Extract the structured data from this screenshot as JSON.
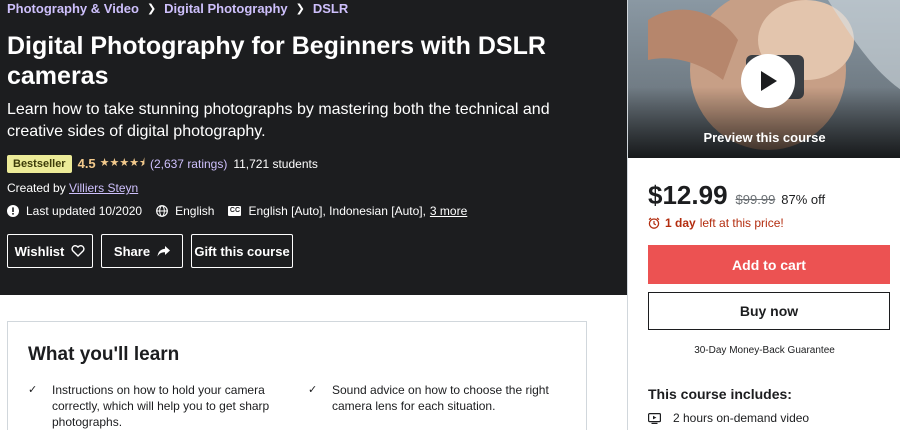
{
  "breadcrumb": [
    "Photography & Video",
    "Digital Photography",
    "DSLR"
  ],
  "course": {
    "title": "Digital Photography for Beginners with DSLR cameras",
    "subtitle": "Learn how to take stunning photographs by mastering both the technical and creative sides of digital photography.",
    "badge": "Bestseller",
    "rating": "4.5",
    "rating_count": "(2,637 ratings)",
    "students": "11,721 students",
    "created_by_label": "Created by",
    "author": "Villiers Steyn",
    "last_updated": "Last updated 10/2020",
    "language": "English",
    "captions": "English [Auto], Indonesian [Auto],",
    "captions_more": "3 more"
  },
  "actions": {
    "wishlist": "Wishlist",
    "share": "Share",
    "gift": "Gift this course"
  },
  "sidebar": {
    "preview_label": "Preview this course",
    "price": "$12.99",
    "original_price": "$99.99",
    "discount": "87% off",
    "timer_bold": "1 day",
    "timer_rest": "left at this price!",
    "add_to_cart": "Add to cart",
    "buy_now": "Buy now",
    "guarantee": "30-Day Money-Back Guarantee",
    "includes_title": "This course includes:",
    "includes": [
      "2 hours on-demand video"
    ]
  },
  "learn": {
    "title": "What you'll learn",
    "items": [
      "Instructions on how to hold your camera correctly, which will help you to get sharp photographs.",
      "Sound advice on how to choose the right camera lens for each situation."
    ]
  },
  "colors": {
    "hero_bg": "#1c1d1f",
    "link_purple": "#cec0fc",
    "star_gold": "#f3ca8c",
    "cart_red": "#ec5252",
    "timer_red": "#b32d0f"
  }
}
